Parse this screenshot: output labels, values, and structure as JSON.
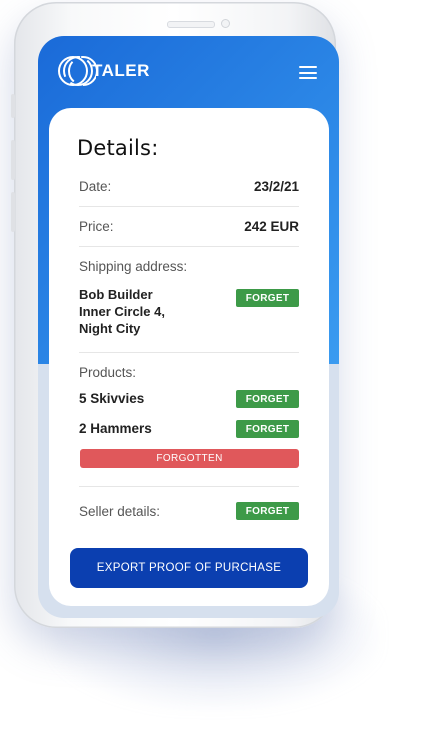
{
  "app": {
    "logo_text": "TALER"
  },
  "details": {
    "title": "Details:",
    "date_label": "Date:",
    "date_value": "23/2/21",
    "price_label": "Price:",
    "price_value": "242 EUR",
    "shipping_label": "Shipping address:",
    "shipping_lines": [
      "Bob Builder",
      "Inner Circle 4,",
      "Night City"
    ],
    "products_label": "Products:",
    "products": [
      {
        "name": "5 Skivvies",
        "action": "FORGET"
      },
      {
        "name": "2 Hammers",
        "action": "FORGET"
      }
    ],
    "forgotten_label": "FORGOTTEN",
    "seller_label": "Seller details:",
    "forget_label": "FORGET"
  },
  "export_button": "EXPORT PROOF OF PURCHASE",
  "colors": {
    "header_blue": "#2b86e6",
    "forget_green": "#3d9a48",
    "forgotten_red": "#e0585b",
    "export_blue": "#0b3fb0"
  }
}
